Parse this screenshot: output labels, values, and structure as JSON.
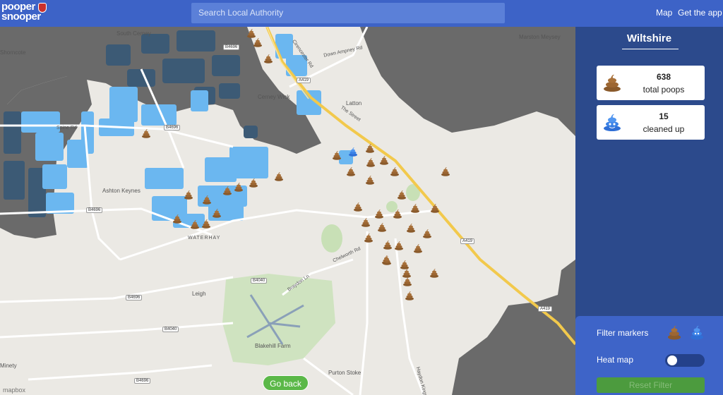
{
  "header": {
    "logo_line1": "pooper",
    "logo_line2": "snooper",
    "search_placeholder": "Search Local Authority",
    "nav": [
      "Map",
      "Get the app"
    ]
  },
  "map": {
    "place_labels": [
      "South Cerney",
      "Shorncote",
      "Cerney Wick",
      "Latton",
      "Marston Meysey",
      "Ashton Keynes",
      "WATERHAY",
      "Leigh",
      "Blakehill Farm",
      "Minety",
      "Purton Stoke"
    ],
    "road_labels": [
      "Spine Rd",
      "Down Ampney Rd",
      "Cirencester Rd",
      "The Street",
      "Chelworth Rd",
      "Braydon Ln",
      "Haydon Kings"
    ],
    "road_tags": [
      "B4696",
      "A419",
      "B4696",
      "B4696",
      "A419",
      "B4040",
      "B4696",
      "B4040",
      "B4696",
      "A419"
    ],
    "go_back_label": "Go back",
    "attribution": "mapbox"
  },
  "sidebar": {
    "region": "Wiltshire",
    "stats": [
      {
        "value": "638",
        "label": "total poops",
        "icon": "poop-brown-icon"
      },
      {
        "value": "15",
        "label": "cleaned up",
        "icon": "poop-blue-icon"
      }
    ],
    "filter_label": "Filter markers",
    "heatmap_label": "Heat map",
    "heatmap_on": false,
    "reset_label": "Reset Filter"
  },
  "colors": {
    "header": "#3d63c7",
    "sidebar": "#2c4a8c",
    "water": "#6bb7f0",
    "poop": "#8a5a2b",
    "button_green": "#5bb848"
  }
}
